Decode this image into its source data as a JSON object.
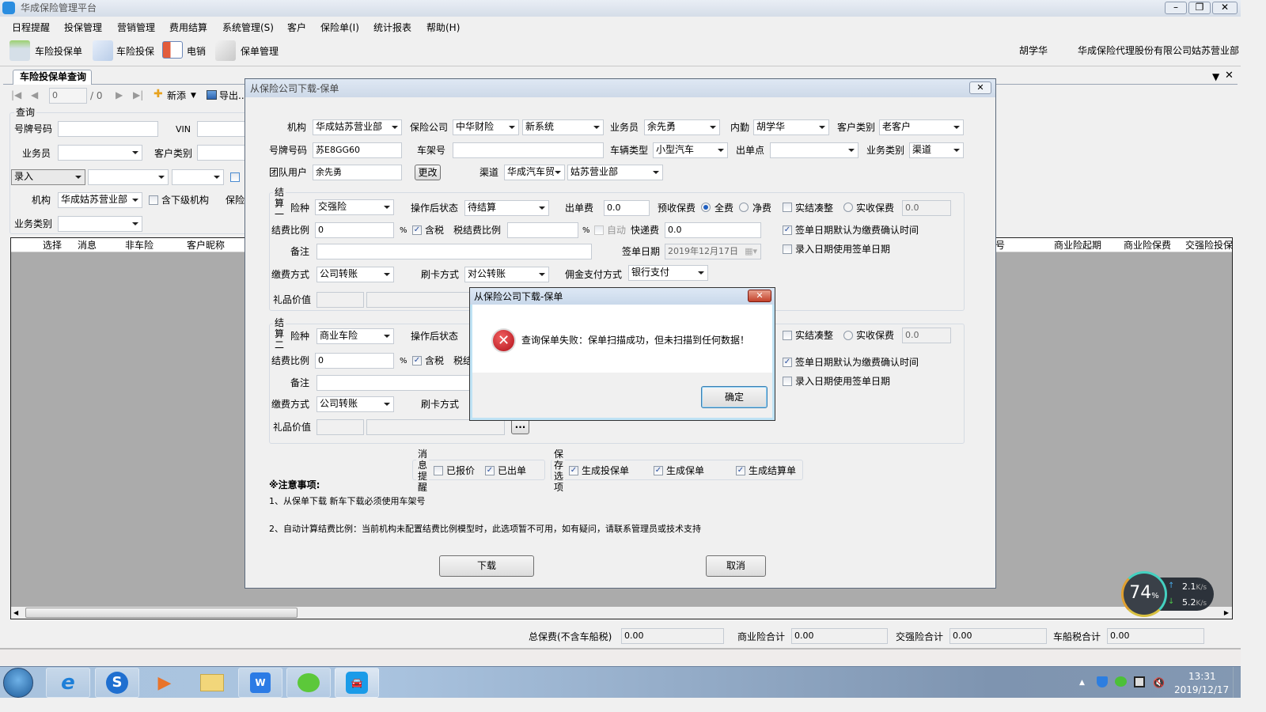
{
  "app": {
    "title": "华成保险管理平台"
  },
  "menu": [
    "日程提醒",
    "投保管理",
    "营销管理",
    "费用结算",
    "系统管理(S)",
    "客户",
    "保险单(I)",
    "统计报表",
    "帮助(H)"
  ],
  "toolbar": {
    "items": [
      "车险投保单",
      "车险投保",
      "电销",
      "保单管理"
    ],
    "user": "胡学华",
    "org": "华成保险代理股份有限公司姑苏营业部"
  },
  "tab": {
    "label": "车险投保单查询"
  },
  "pager": {
    "page": "0",
    "total": "/ 0",
    "add": "新添",
    "export": "导出..."
  },
  "query": {
    "legend": "查询",
    "plate_label": "号牌号码",
    "vin_label": "VIN",
    "salesman_label": "业务员",
    "customer_type_label": "客户类别",
    "status_value": "录入",
    "org_label": "机构",
    "org_value": "华成姑苏营业部",
    "include_sub": "含下级机构",
    "insurer_label": "保险",
    "biz_type_label": "业务类别"
  },
  "grid": {
    "columns_left": [
      "选择",
      "消息",
      "非车险",
      "客户昵称"
    ],
    "columns_right": [
      "号",
      "商业险起期",
      "商业险保费",
      "交强险投保"
    ]
  },
  "totals": {
    "total_label": "总保费(不含车船税)",
    "total": "0.00",
    "commercial_label": "商业险合计",
    "commercial": "0.00",
    "compulsory_label": "交强险合计",
    "compulsory": "0.00",
    "vessel_label": "车船税合计",
    "vessel": "0.00"
  },
  "dialog": {
    "title": "从保险公司下载-保单",
    "org_label": "机构",
    "org": "华成姑苏营业部",
    "insurer_label": "保险公司",
    "insurer": "中华财险",
    "system": "新系统",
    "salesman_label": "业务员",
    "salesman": "余先勇",
    "internal_label": "内勤",
    "internal": "胡学华",
    "customer_type_label": "客户类别",
    "customer_type": "老客户",
    "plate_label": "号牌号码",
    "plate": "苏E8GG60",
    "frame_label": "车架号",
    "vehicle_type_label": "车辆类型",
    "vehicle_type": "小型汽车",
    "issue_point_label": "出单点",
    "biz_type_label": "业务类别",
    "biz_type": "渠道",
    "team_label": "团队用户",
    "team": "余先勇",
    "change_btn": "更改",
    "channel_label": "渠道",
    "channel1": "华成汽车贸",
    "channel2": "姑苏营业部",
    "s1": {
      "legend": "结算一",
      "kind_label": "险种",
      "kind": "交强险",
      "status_label": "操作后状态",
      "status": "待结算",
      "fee_label": "出单费",
      "fee": "0.0",
      "prem_label": "预收保费",
      "full": "全费",
      "net": "净费",
      "round": "实结凑整",
      "actual": "实收保费",
      "actual_val": "0.0",
      "ratio_label": "结费比例",
      "ratio": "0",
      "pct": "%",
      "tax": "含税",
      "tax_ratio_label": "税结费比例",
      "auto": "自动",
      "express_label": "快递费",
      "express": "0.0",
      "sign_default": "签单日期默认为缴费确认时间",
      "note_label": "备注",
      "sign_date_label": "签单日期",
      "sign_date": "2019年12月17日",
      "entry_date": "录入日期使用签单日期",
      "pay_label": "缴费方式",
      "pay": "公司转账",
      "card_label": "刷卡方式",
      "card": "对公转账",
      "comm_label": "佣金支付方式",
      "comm": "银行支付",
      "gift_label": "礼品价值"
    },
    "s2": {
      "legend": "结算二",
      "kind_label": "险种",
      "kind": "商业车险",
      "status_label": "操作后状态",
      "round": "实结凑整",
      "actual": "实收保费",
      "actual_val": "0.0",
      "ratio_label": "结费比例",
      "ratio": "0",
      "pct": "%",
      "tax": "含税",
      "tax_ratio_label": "税结",
      "sign_default": "签单日期默认为缴费确认时间",
      "note_label": "备注",
      "entry_date": "录入日期使用签单日期",
      "pay_label": "缴费方式",
      "pay": "公司转账",
      "card_label": "刷卡方式",
      "gift_label": "礼品价值",
      "more": "..."
    },
    "remind": {
      "legend": "消息提醒",
      "quoted": "已报价",
      "issued": "已出单"
    },
    "save": {
      "legend": "保存选项",
      "gen_app": "生成投保单",
      "gen_policy": "生成保单",
      "gen_settle": "生成结算单"
    },
    "notes_title": "※注意事项:",
    "note1": "1、从保单下载 新车下载必须使用车架号",
    "note2": "2、自动计算结费比例：当前机构未配置结费比例模型时，此选项暂不可用，如有疑问，请联系管理员或技术支持",
    "download": "下载",
    "cancel": "取消"
  },
  "msgbox": {
    "title": "从保险公司下载-保单",
    "message": "查询保单失败：保单扫描成功，但未扫描到任何数据！",
    "ok": "确定"
  },
  "net": {
    "percent": "74",
    "pct_sign": "%",
    "up": "2.1",
    "down": "5.2",
    "unit": "K/s"
  },
  "clock": {
    "time": "13:31",
    "date": "2019/12/17"
  }
}
